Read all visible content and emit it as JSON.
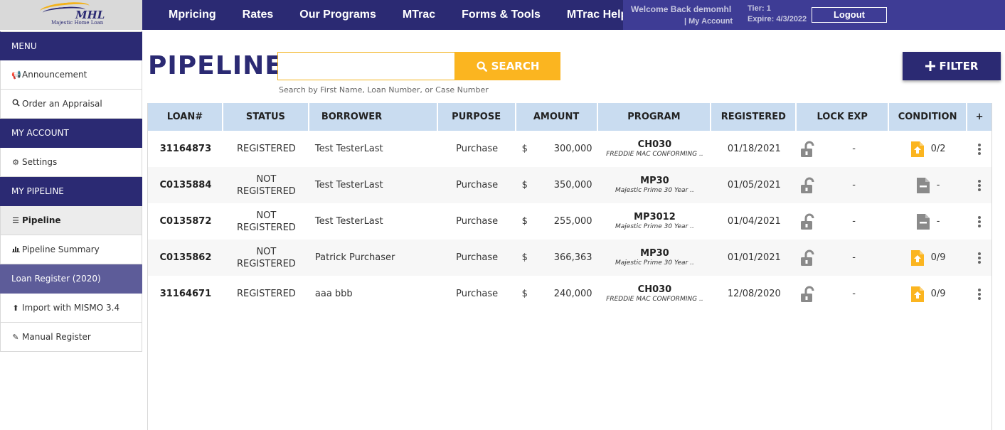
{
  "logo": {
    "brand": "MHL",
    "sub": "Majestic Home Loan"
  },
  "nav": {
    "items": [
      "Mpricing",
      "Rates",
      "Our Programs",
      "MTrac",
      "Forms & Tools",
      "MTrac Help"
    ]
  },
  "account": {
    "welcome": "Welcome Back demomhl",
    "my_account": "| My Account",
    "tier": "Tier: 1",
    "expire": "Expire: 4/3/2022",
    "logout": "Logout"
  },
  "sidebar": {
    "items": [
      {
        "label": "MENU",
        "type": "header"
      },
      {
        "label": "Announcement",
        "icon": "megaphone-icon"
      },
      {
        "label": "Order an Appraisal",
        "icon": "search-icon"
      },
      {
        "label": "MY ACCOUNT",
        "type": "header"
      },
      {
        "label": "Settings",
        "icon": "gear-icon"
      },
      {
        "label": "MY PIPELINE",
        "type": "header"
      },
      {
        "label": "Pipeline",
        "icon": "list-icon",
        "state": "active"
      },
      {
        "label": "Pipeline Summary",
        "icon": "bar-chart-icon"
      },
      {
        "label": "Loan Register (2020)",
        "state": "selected"
      },
      {
        "label": "Import with MISMO 3.4",
        "icon": "upload-icon"
      },
      {
        "label": "Manual Register",
        "icon": "edit-icon"
      }
    ]
  },
  "main": {
    "title": "PIPELINE",
    "search": {
      "value": "",
      "placeholder": "",
      "button": "SEARCH",
      "hint": "Search by First Name, Loan Number, or Case Number"
    },
    "filter_button": "FILTER"
  },
  "table": {
    "columns": [
      "LOAN#",
      "STATUS",
      "BORROWER",
      "PURPOSE",
      "AMOUNT",
      "PROGRAM",
      "REGISTERED",
      "LOCK EXP",
      "CONDITION",
      "+"
    ],
    "rows": [
      {
        "loan": "31164873",
        "status": "REGISTERED",
        "borrower": "Test TesterLast",
        "purpose": "Purchase",
        "currency": "$",
        "amount": "300,000",
        "program_code": "CH030",
        "program_desc": "FREDDIE MAC CONFORMING ..",
        "registered": "01/18/2021",
        "lock_exp": "-",
        "condition_icon": "upload-doc-icon",
        "condition": "0/2"
      },
      {
        "loan": "C0135884",
        "status": "NOT REGISTERED",
        "borrower": "Test TesterLast",
        "purpose": "Purchase",
        "currency": "$",
        "amount": "350,000",
        "program_code": "MP30",
        "program_desc": "Majestic Prime 30 Year ..",
        "registered": "01/05/2021",
        "lock_exp": "-",
        "condition_icon": "doc-icon",
        "condition": "-"
      },
      {
        "loan": "C0135872",
        "status": "NOT REGISTERED",
        "borrower": "Test TesterLast",
        "purpose": "Purchase",
        "currency": "$",
        "amount": "255,000",
        "program_code": "MP3012",
        "program_desc": "Majestic Prime 30 Year ..",
        "registered": "01/04/2021",
        "lock_exp": "-",
        "condition_icon": "doc-icon",
        "condition": "-"
      },
      {
        "loan": "C0135862",
        "status": "NOT REGISTERED",
        "borrower": "Patrick Purchaser",
        "purpose": "Purchase",
        "currency": "$",
        "amount": "366,363",
        "program_code": "MP30",
        "program_desc": "Majestic Prime 30 Year ..",
        "registered": "01/01/2021",
        "lock_exp": "-",
        "condition_icon": "upload-doc-icon",
        "condition": "0/9"
      },
      {
        "loan": "31164671",
        "status": "REGISTERED",
        "borrower": "aaa bbb",
        "purpose": "Purchase",
        "currency": "$",
        "amount": "240,000",
        "program_code": "CH030",
        "program_desc": "FREDDIE MAC CONFORMING ..",
        "registered": "12/08/2020",
        "lock_exp": "-",
        "condition_icon": "upload-doc-icon",
        "condition": "0/9"
      }
    ]
  },
  "colors": {
    "brand": "#2b2a73",
    "accent": "#fbb520",
    "header_row": "#c9dcf0",
    "selected_side": "#5d5c99"
  }
}
